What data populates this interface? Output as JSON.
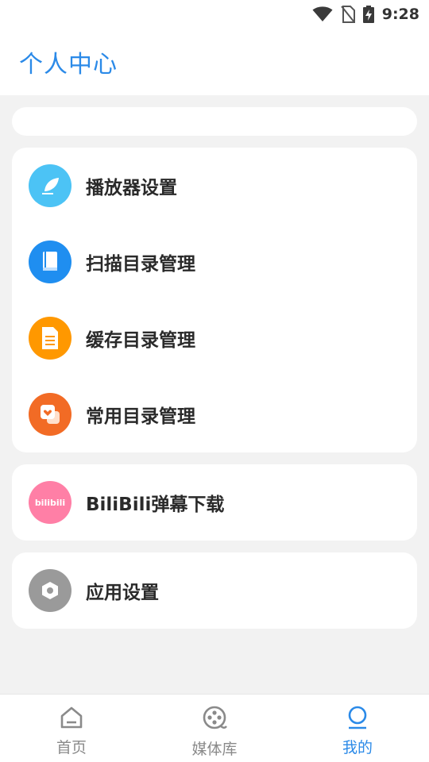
{
  "status_bar": {
    "time": "9:28"
  },
  "header": {
    "title": "个人中心"
  },
  "menu": {
    "player_settings": "播放器设置",
    "scan_dirs": "扫描目录管理",
    "cache_dirs": "缓存目录管理",
    "common_dirs": "常用目录管理",
    "bilibili": "BiliBili弹幕下载",
    "bilibili_logo_text": "bilibili",
    "app_settings": "应用设置"
  },
  "colors": {
    "accent": "#2b8ae8",
    "player_icon": "#4cc3f5",
    "scan_icon": "#1f8ef0",
    "cache_icon": "#ff9800",
    "common_icon": "#f26b25",
    "bili_icon": "#ff7fa6",
    "settings_icon": "#9a9a9a"
  },
  "icons": {
    "player_settings": "feather-pen-icon",
    "scan_dirs": "book-icon",
    "cache_dirs": "document-icon",
    "common_dirs": "heart-folder-icon",
    "bilibili": "bilibili-logo-icon",
    "app_settings": "hexagon-gear-icon"
  },
  "bottom_nav": {
    "items": [
      {
        "label": "首页",
        "icon": "home-icon",
        "active": false
      },
      {
        "label": "媒体库",
        "icon": "film-reel-icon",
        "active": false
      },
      {
        "label": "我的",
        "icon": "person-icon",
        "active": true
      }
    ]
  }
}
